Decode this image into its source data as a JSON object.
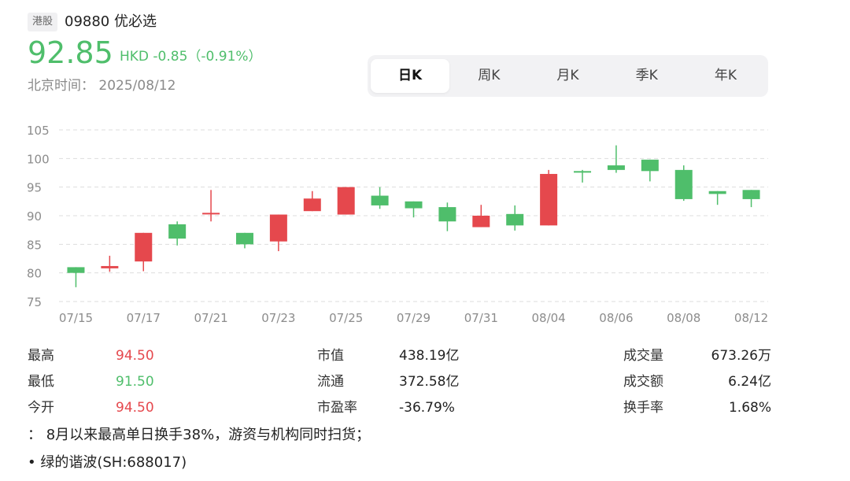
{
  "header": {
    "market_badge": "港股",
    "title": "09880 优必选",
    "price": "92.85",
    "change": "HKD -0.85（-0.91%）",
    "datetime": "北京时间： 2025/08/12"
  },
  "tabs": [
    {
      "label": "日K",
      "active": true
    },
    {
      "label": "周K",
      "active": false
    },
    {
      "label": "月K",
      "active": false
    },
    {
      "label": "季K",
      "active": false
    },
    {
      "label": "年K",
      "active": false
    }
  ],
  "colors": {
    "up": "#e5484d",
    "down": "#4fbe6b",
    "grid": "#dddddd",
    "axis_text": "#8c8c8c"
  },
  "chart_data": {
    "type": "candlestick",
    "ylim": [
      75,
      105
    ],
    "y_ticks": [
      "105",
      "100",
      "95",
      "90",
      "85",
      "80",
      "75"
    ],
    "x_labels": [
      "07/15",
      "07/17",
      "07/21",
      "07/23",
      "07/25",
      "07/29",
      "07/31",
      "08/04",
      "08/06",
      "08/08",
      "08/12"
    ],
    "candles": [
      {
        "open": 81.0,
        "close": 80.0,
        "high": 81.0,
        "low": 77.5
      },
      {
        "open": 80.8,
        "close": 81.2,
        "high": 83.0,
        "low": 80.2
      },
      {
        "open": 82.0,
        "close": 87.0,
        "high": 87.0,
        "low": 80.3
      },
      {
        "open": 88.5,
        "close": 86.0,
        "high": 89.0,
        "low": 84.8
      },
      {
        "open": 90.3,
        "close": 90.5,
        "high": 94.5,
        "low": 89.0
      },
      {
        "open": 87.0,
        "close": 85.0,
        "high": 87.0,
        "low": 84.3
      },
      {
        "open": 85.5,
        "close": 90.2,
        "high": 90.2,
        "low": 83.8
      },
      {
        "open": 90.8,
        "close": 93.0,
        "high": 94.3,
        "low": 90.8
      },
      {
        "open": 90.2,
        "close": 95.0,
        "high": 95.0,
        "low": 90.2
      },
      {
        "open": 93.5,
        "close": 91.8,
        "high": 95.0,
        "low": 91.2
      },
      {
        "open": 92.5,
        "close": 91.3,
        "high": 92.5,
        "low": 89.7
      },
      {
        "open": 91.5,
        "close": 89.0,
        "high": 92.3,
        "low": 87.3
      },
      {
        "open": 88.0,
        "close": 90.0,
        "high": 91.9,
        "low": 88.0
      },
      {
        "open": 90.3,
        "close": 88.3,
        "high": 91.8,
        "low": 87.4
      },
      {
        "open": 88.3,
        "close": 97.3,
        "high": 98.0,
        "low": 88.3
      },
      {
        "open": 97.8,
        "close": 97.6,
        "high": 98.0,
        "low": 95.8
      },
      {
        "open": 98.8,
        "close": 98.0,
        "high": 102.3,
        "low": 97.5
      },
      {
        "open": 99.8,
        "close": 97.8,
        "high": 99.8,
        "low": 96.0
      },
      {
        "open": 98.0,
        "close": 92.9,
        "high": 98.8,
        "low": 92.6
      },
      {
        "open": 94.3,
        "close": 93.8,
        "high": 94.3,
        "low": 91.9
      },
      {
        "open": 94.5,
        "close": 92.9,
        "high": 94.5,
        "low": 91.5
      }
    ]
  },
  "stats": {
    "rows": [
      [
        {
          "label": "最高",
          "value": "94.50",
          "tone": "red"
        },
        {
          "label": "市值",
          "value": "438.19亿",
          "tone": "dark"
        },
        {
          "label": "成交量",
          "value": "673.26万",
          "tone": "dark"
        }
      ],
      [
        {
          "label": "最低",
          "value": "91.50",
          "tone": "green"
        },
        {
          "label": "流通",
          "value": "372.58亿",
          "tone": "dark"
        },
        {
          "label": "成交额",
          "value": "6.24亿",
          "tone": "dark"
        }
      ],
      [
        {
          "label": "今开",
          "value": "94.50",
          "tone": "red"
        },
        {
          "label": "市盈率",
          "value": "-36.79%",
          "tone": "dark"
        },
        {
          "label": "换手率",
          "value": "1.68%",
          "tone": "dark"
        }
      ]
    ]
  },
  "news": [
    "： 8月以来最高单日换手38%，游资与机构同时扫货；",
    "• 绿的谐波(SH:688017)"
  ]
}
